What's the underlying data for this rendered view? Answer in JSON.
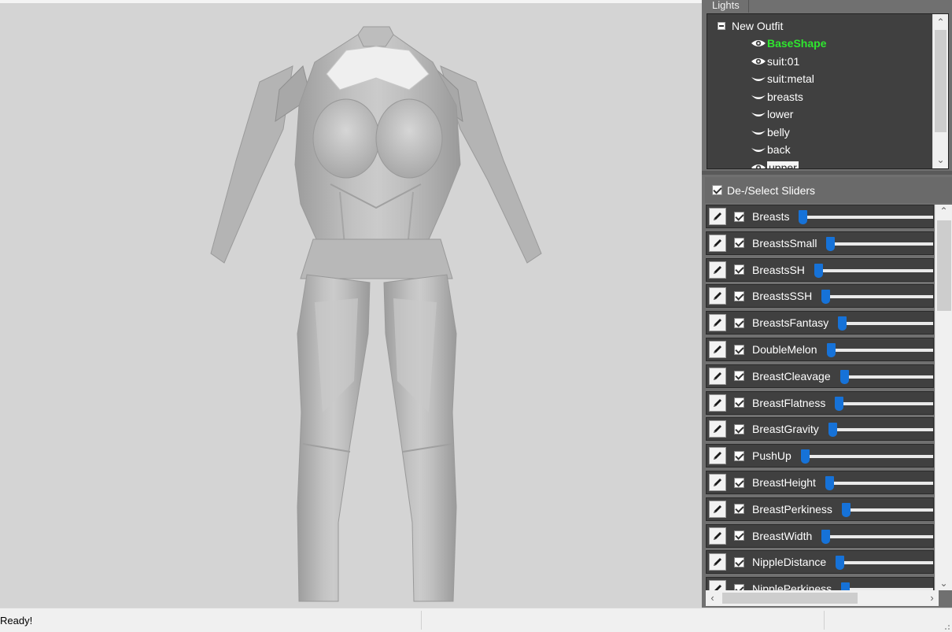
{
  "lights_tab": "Lights",
  "tree": {
    "root": "New Outfit",
    "items": [
      {
        "label": "BaseShape",
        "icon": "eye-open-icon",
        "state": "active"
      },
      {
        "label": "suit:01",
        "icon": "eye-open-icon",
        "state": "normal"
      },
      {
        "label": "suit:metal",
        "icon": "eye-closed-icon",
        "state": "normal"
      },
      {
        "label": "breasts",
        "icon": "eye-closed-icon",
        "state": "normal"
      },
      {
        "label": "lower",
        "icon": "eye-closed-icon",
        "state": "normal"
      },
      {
        "label": "belly",
        "icon": "eye-closed-icon",
        "state": "normal"
      },
      {
        "label": "back",
        "icon": "eye-closed-icon",
        "state": "normal"
      },
      {
        "label": "upper",
        "icon": "eye-open-icon",
        "state": "highlight"
      }
    ]
  },
  "sliders_header": {
    "label": "De-/Select Sliders",
    "checked": true
  },
  "sliders": [
    {
      "name": "Breasts",
      "value": 0.0,
      "checked": true
    },
    {
      "name": "BreastsSmall",
      "value": 0.0,
      "checked": true
    },
    {
      "name": "BreastsSH",
      "value": 0.0,
      "checked": true
    },
    {
      "name": "BreastsSSH",
      "value": 0.0,
      "checked": true
    },
    {
      "name": "BreastsFantasy",
      "value": 0.0,
      "checked": true
    },
    {
      "name": "DoubleMelon",
      "value": 0.0,
      "checked": true
    },
    {
      "name": "BreastCleavage",
      "value": 0.0,
      "checked": true
    },
    {
      "name": "BreastFlatness",
      "value": 0.0,
      "checked": true
    },
    {
      "name": "BreastGravity",
      "value": 0.0,
      "checked": true
    },
    {
      "name": "PushUp",
      "value": 0.0,
      "checked": true
    },
    {
      "name": "BreastHeight",
      "value": 0.0,
      "checked": true
    },
    {
      "name": "BreastPerkiness",
      "value": 0.0,
      "checked": true
    },
    {
      "name": "BreastWidth",
      "value": 0.0,
      "checked": true
    },
    {
      "name": "NippleDistance",
      "value": 0.0,
      "checked": true
    },
    {
      "name": "NipplePerkiness",
      "value": 0.0,
      "checked": true
    }
  ],
  "status": {
    "text": "Ready!"
  },
  "colors": {
    "active_shape": "#2ee62e",
    "slider_thumb": "#1672d8",
    "panel_bg": "#404040",
    "viewport_bg": "#d4d4d4"
  }
}
